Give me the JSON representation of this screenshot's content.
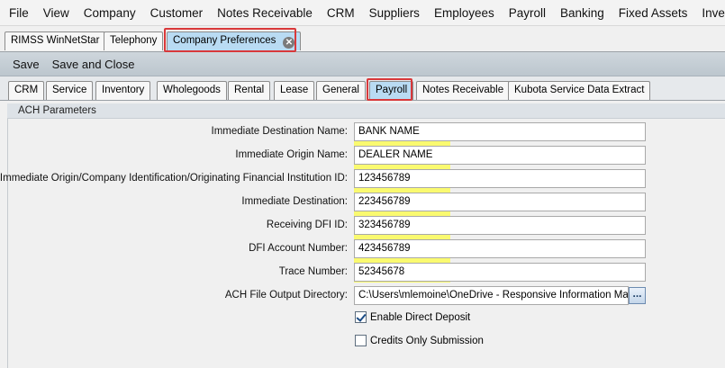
{
  "menu": [
    "File",
    "View",
    "Company",
    "Customer",
    "Notes Receivable",
    "CRM",
    "Suppliers",
    "Employees",
    "Payroll",
    "Banking",
    "Fixed Assets",
    "Inventory"
  ],
  "doc_tabs": [
    {
      "label": "RIMSS WinNetStar"
    },
    {
      "label": "Telephony"
    },
    {
      "label": "Company Preferences",
      "active": true
    }
  ],
  "close_glyph": "✕",
  "toolbar": {
    "save_label": "Save",
    "save_close_label": "Save and Close"
  },
  "settings_tabs": [
    "CRM",
    "Service",
    "Inventory",
    "Wholegoods",
    "Rental",
    "Lease",
    "General",
    "Payroll",
    "Notes Receivable",
    "Kubota Service Data Extract"
  ],
  "active_settings_tab": "Payroll",
  "section": {
    "title": "ACH Parameters"
  },
  "fields": [
    {
      "label": "Immediate Destination Name:",
      "value": "BANK NAME"
    },
    {
      "label": "Immediate Origin Name:",
      "value": "DEALER NAME"
    },
    {
      "label": "Immediate Origin/Company Identification/Originating Financial Institution ID:",
      "value": "123456789"
    },
    {
      "label": "Immediate Destination:",
      "value": "223456789"
    },
    {
      "label": "Receiving DFI ID:",
      "value": "323456789"
    },
    {
      "label": "DFI Account Number:",
      "value": "423456789"
    },
    {
      "label": "Trace Number:",
      "value": "52345678"
    }
  ],
  "output_dir": {
    "label": "ACH File Output Directory:",
    "value": "C:\\Users\\mlemoine\\OneDrive - Responsive Information Man...",
    "browse_label": "..."
  },
  "checkboxes": [
    {
      "label": "Enable Direct Deposit",
      "checked": true
    },
    {
      "label": "Credits Only Submission",
      "checked": false
    }
  ],
  "colors": {
    "highlight": "#fbfb62",
    "callout": "#d9383a",
    "active_tab": "#b9dbf3"
  }
}
